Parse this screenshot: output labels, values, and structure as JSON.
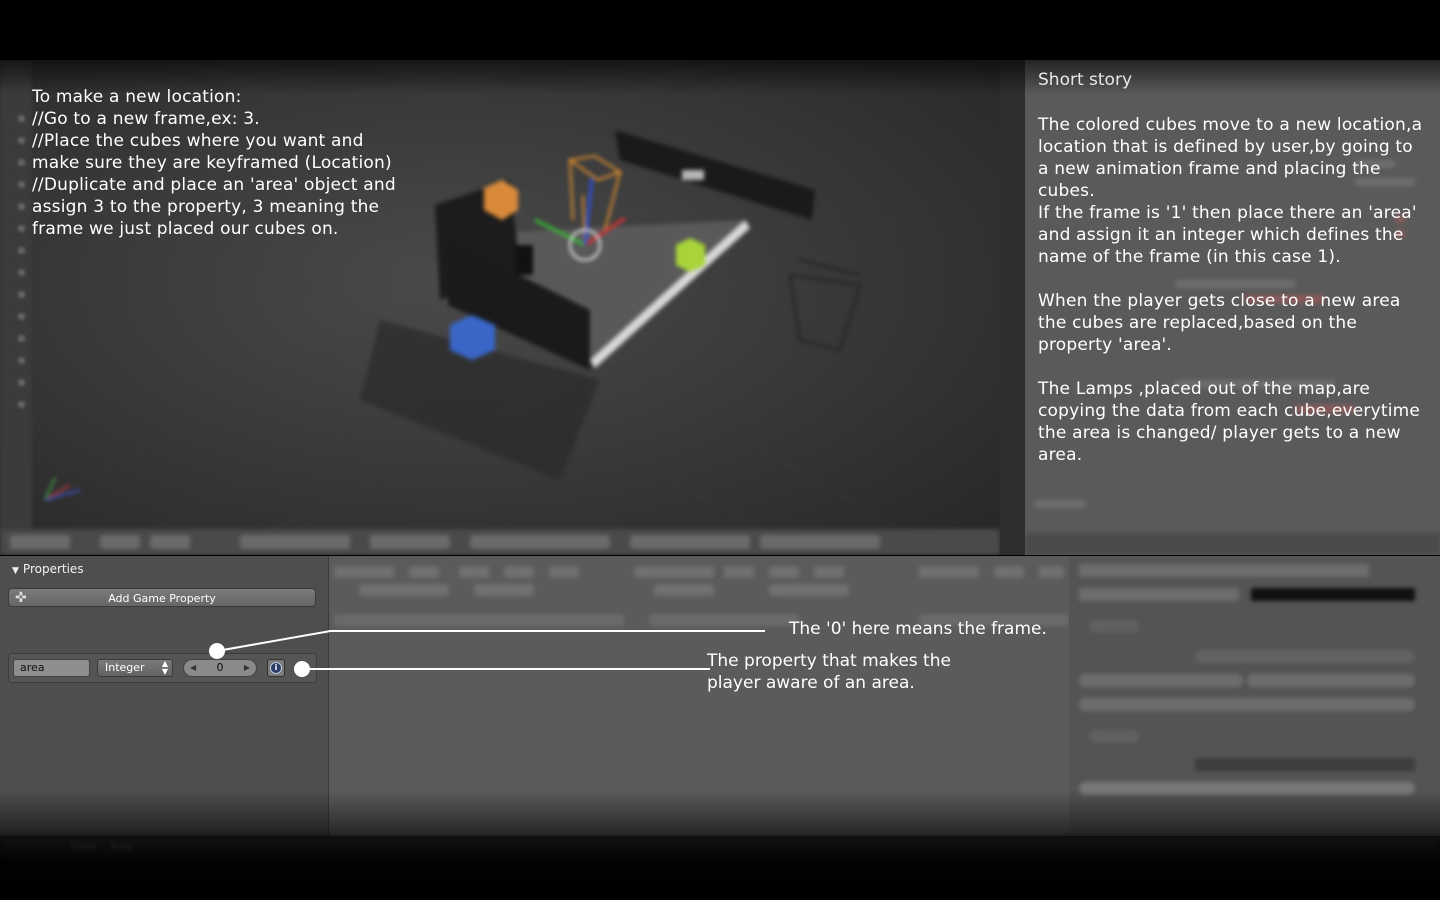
{
  "overlay": {
    "instructions": "To make a new location:\n//Go to a new frame,ex: 3.\n//Place the cubes where you want and make sure they are keyframed (Location)\n//Duplicate and place an 'area' object and assign 3 to the property, 3 meaning the frame we just placed our cubes on.",
    "story_title": "Short story",
    "story_body": "The colored cubes move to a new location,a location that is defined by user,by going to a new animation frame and placing the cubes.\nIf the frame is '1' then place there an 'area' and assign it an integer which defines the name of the frame (in this case 1).\n\nWhen the player gets close to a new area the cubes are replaced,based on the property 'area'.\n\nThe Lamps ,placed out of the map,are copying the data from each cube,everytime the area is changed/ player gets to a new area.",
    "annotation_frame": "The '0' here means the frame.",
    "annotation_property": "The property that makes the player aware of an area."
  },
  "properties_panel": {
    "title": "Properties",
    "add_button": "Add Game Property",
    "property": {
      "name": "area",
      "type": "Integer",
      "value": "0"
    }
  },
  "bottom_bar": {
    "items": [
      "View",
      "Add"
    ]
  },
  "colors": {
    "cube_orange": "#d88a3a",
    "cube_blue": "#3a66c8",
    "cube_green": "#a8d43a"
  }
}
